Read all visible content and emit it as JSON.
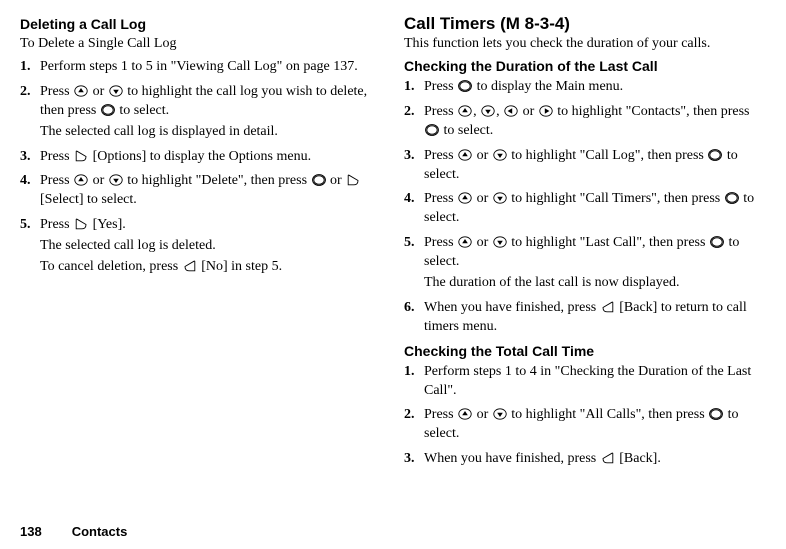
{
  "left": {
    "heading": "Deleting a Call Log",
    "subheading": "To Delete a Single Call Log",
    "steps": [
      {
        "num": "1.",
        "segments": [
          {
            "t": "text",
            "v": "Perform steps 1 to 5 in \"Viewing Call Log\" on page 137."
          }
        ]
      },
      {
        "num": "2.",
        "segments": [
          {
            "t": "text",
            "v": "Press "
          },
          {
            "t": "icon",
            "name": "up-key-icon"
          },
          {
            "t": "text",
            "v": " or "
          },
          {
            "t": "icon",
            "name": "down-key-icon"
          },
          {
            "t": "text",
            "v": " to highlight the call log you wish to delete, then press "
          },
          {
            "t": "icon",
            "name": "center-key-icon"
          },
          {
            "t": "text",
            "v": " to select."
          }
        ],
        "sub": [
          {
            "segments": [
              {
                "t": "text",
                "v": "The selected call log is displayed in detail."
              }
            ]
          }
        ]
      },
      {
        "num": "3.",
        "segments": [
          {
            "t": "text",
            "v": "Press "
          },
          {
            "t": "icon",
            "name": "left-softkey-icon"
          },
          {
            "t": "text",
            "v": " [Options] to display the Options menu."
          }
        ]
      },
      {
        "num": "4.",
        "segments": [
          {
            "t": "text",
            "v": "Press "
          },
          {
            "t": "icon",
            "name": "up-key-icon"
          },
          {
            "t": "text",
            "v": " or "
          },
          {
            "t": "icon",
            "name": "down-key-icon"
          },
          {
            "t": "text",
            "v": " to highlight \"Delete\", then press "
          },
          {
            "t": "icon",
            "name": "center-key-icon"
          },
          {
            "t": "text",
            "v": " or "
          },
          {
            "t": "icon",
            "name": "left-softkey-icon"
          },
          {
            "t": "text",
            "v": " [Select] to select."
          }
        ]
      },
      {
        "num": "5.",
        "segments": [
          {
            "t": "text",
            "v": "Press "
          },
          {
            "t": "icon",
            "name": "left-softkey-icon"
          },
          {
            "t": "text",
            "v": " [Yes]."
          }
        ],
        "sub": [
          {
            "segments": [
              {
                "t": "text",
                "v": "The selected call log is deleted."
              }
            ]
          },
          {
            "segments": [
              {
                "t": "text",
                "v": "To cancel deletion, press "
              },
              {
                "t": "icon",
                "name": "right-softkey-icon"
              },
              {
                "t": "text",
                "v": " [No] in step 5."
              }
            ]
          }
        ]
      }
    ]
  },
  "right": {
    "heading": "Call Timers",
    "mcode": "(M 8-3-4)",
    "intro": "This function lets you check the duration of your calls.",
    "block1_heading": "Checking the Duration of the Last Call",
    "block1_steps": [
      {
        "num": "1.",
        "segments": [
          {
            "t": "text",
            "v": "Press "
          },
          {
            "t": "icon",
            "name": "center-key-icon"
          },
          {
            "t": "text",
            "v": " to display the Main menu."
          }
        ]
      },
      {
        "num": "2.",
        "segments": [
          {
            "t": "text",
            "v": "Press "
          },
          {
            "t": "icon",
            "name": "up-key-icon"
          },
          {
            "t": "text",
            "v": ", "
          },
          {
            "t": "icon",
            "name": "down-key-icon"
          },
          {
            "t": "text",
            "v": ", "
          },
          {
            "t": "icon",
            "name": "left-key-icon"
          },
          {
            "t": "text",
            "v": " or "
          },
          {
            "t": "icon",
            "name": "right-key-icon"
          },
          {
            "t": "text",
            "v": " to highlight \"Contacts\", then press "
          },
          {
            "t": "icon",
            "name": "center-key-icon"
          },
          {
            "t": "text",
            "v": " to select."
          }
        ]
      },
      {
        "num": "3.",
        "segments": [
          {
            "t": "text",
            "v": "Press "
          },
          {
            "t": "icon",
            "name": "up-key-icon"
          },
          {
            "t": "text",
            "v": " or "
          },
          {
            "t": "icon",
            "name": "down-key-icon"
          },
          {
            "t": "text",
            "v": " to highlight \"Call Log\", then press "
          },
          {
            "t": "icon",
            "name": "center-key-icon"
          },
          {
            "t": "text",
            "v": " to select."
          }
        ]
      },
      {
        "num": "4.",
        "segments": [
          {
            "t": "text",
            "v": "Press "
          },
          {
            "t": "icon",
            "name": "up-key-icon"
          },
          {
            "t": "text",
            "v": " or "
          },
          {
            "t": "icon",
            "name": "down-key-icon"
          },
          {
            "t": "text",
            "v": " to highlight \"Call Timers\", then press "
          },
          {
            "t": "icon",
            "name": "center-key-icon"
          },
          {
            "t": "text",
            "v": " to select."
          }
        ]
      },
      {
        "num": "5.",
        "segments": [
          {
            "t": "text",
            "v": "Press "
          },
          {
            "t": "icon",
            "name": "up-key-icon"
          },
          {
            "t": "text",
            "v": " or "
          },
          {
            "t": "icon",
            "name": "down-key-icon"
          },
          {
            "t": "text",
            "v": " to highlight \"Last Call\", then press "
          },
          {
            "t": "icon",
            "name": "center-key-icon"
          },
          {
            "t": "text",
            "v": " to select."
          }
        ],
        "sub": [
          {
            "segments": [
              {
                "t": "text",
                "v": "The duration of the last call is now displayed."
              }
            ]
          }
        ]
      },
      {
        "num": "6.",
        "segments": [
          {
            "t": "text",
            "v": "When you have finished, press "
          },
          {
            "t": "icon",
            "name": "right-softkey-icon"
          },
          {
            "t": "text",
            "v": " [Back] to return to call timers menu."
          }
        ]
      }
    ],
    "block2_heading": "Checking the Total Call Time",
    "block2_steps": [
      {
        "num": "1.",
        "segments": [
          {
            "t": "text",
            "v": "Perform steps 1 to 4 in \"Checking the Duration of the Last Call\"."
          }
        ]
      },
      {
        "num": "2.",
        "segments": [
          {
            "t": "text",
            "v": "Press "
          },
          {
            "t": "icon",
            "name": "up-key-icon"
          },
          {
            "t": "text",
            "v": " or "
          },
          {
            "t": "icon",
            "name": "down-key-icon"
          },
          {
            "t": "text",
            "v": " to highlight \"All Calls\", then press "
          },
          {
            "t": "icon",
            "name": "center-key-icon"
          },
          {
            "t": "text",
            "v": " to select."
          }
        ]
      },
      {
        "num": "3.",
        "segments": [
          {
            "t": "text",
            "v": "When you have finished, press "
          },
          {
            "t": "icon",
            "name": "right-softkey-icon"
          },
          {
            "t": "text",
            "v": " [Back]."
          }
        ]
      }
    ]
  },
  "footer": {
    "page_num": "138",
    "title": "Contacts"
  }
}
